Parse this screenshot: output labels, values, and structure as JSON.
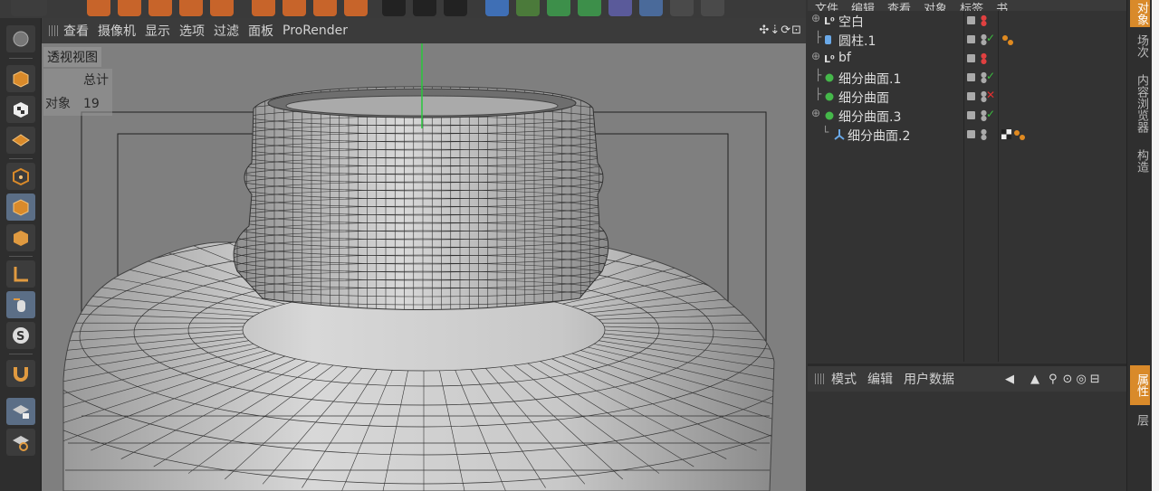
{
  "viewport": {
    "menu": [
      "查看",
      "摄像机",
      "显示",
      "选项",
      "过滤",
      "面板",
      "ProRender"
    ],
    "nav_icons": "✣⇣⟳⊡",
    "title": "透视视图",
    "stats": {
      "header": "总计",
      "label": "对象",
      "value": "19"
    }
  },
  "object_manager": {
    "menu": [
      "文件",
      "编辑",
      "查看",
      "对象",
      "标签",
      "书"
    ],
    "objects": [
      {
        "name": "空白",
        "icon": "null-icon"
      },
      {
        "name": "圆柱.1",
        "icon": "cylinder-icon"
      },
      {
        "name": "bf",
        "icon": "null-icon"
      },
      {
        "name": "细分曲面.1",
        "icon": "subdivision-icon"
      },
      {
        "name": "细分曲面",
        "icon": "subdivision-icon"
      },
      {
        "name": "细分曲面.3",
        "icon": "subdivision-icon"
      },
      {
        "name": "细分曲面.2",
        "icon": "symmetry-icon"
      }
    ]
  },
  "attributes": {
    "menu": [
      "模式",
      "编辑",
      "用户数据"
    ]
  },
  "side_tabs": [
    "对象",
    "场次",
    "内容浏览器",
    "构造",
    "属性",
    "层"
  ],
  "colors": {
    "accent": "#d98a2a",
    "viewport": "#7f7f7f",
    "panel": "#333333"
  }
}
